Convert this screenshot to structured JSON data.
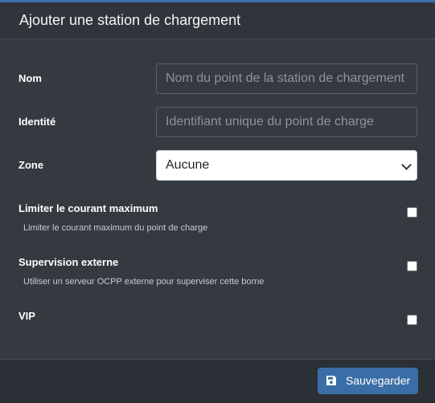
{
  "modal": {
    "title": "Ajouter une station de chargement"
  },
  "form": {
    "name": {
      "label": "Nom",
      "placeholder": "Nom du point de la station de chargement",
      "value": ""
    },
    "identity": {
      "label": "Identité",
      "placeholder": "Identifiant unique du point de charge",
      "value": ""
    },
    "zone": {
      "label": "Zone",
      "selected": "Aucune"
    },
    "limit_current": {
      "label": "Limiter le courant maximum",
      "help": "Limiter le courant maximum du point de charge",
      "checked": false
    },
    "external_supervision": {
      "label": "Supervision externe",
      "help": "Utiliser un serveur OCPP externe pour superviser cette borne",
      "checked": false
    },
    "vip": {
      "label": "VIP",
      "checked": false
    }
  },
  "footer": {
    "save_label": "Sauvegarder",
    "save_icon": "floppy-disk-icon"
  },
  "colors": {
    "accent": "#3f6fa8",
    "button": "#3b6ea6",
    "background": "#343a40"
  }
}
